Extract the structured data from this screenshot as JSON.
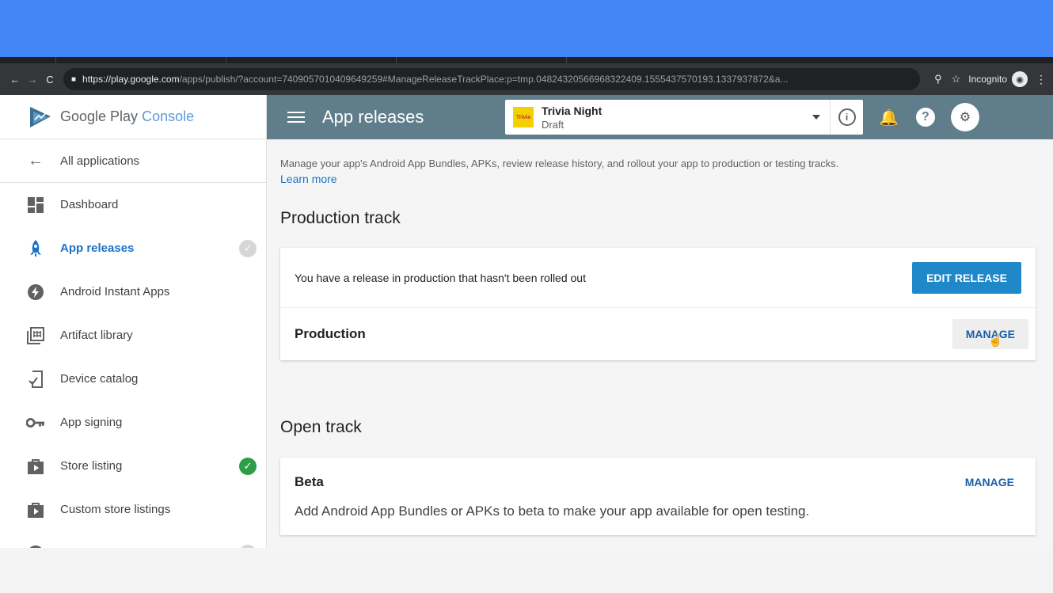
{
  "browser": {
    "url_host": "https://play.google.com",
    "url_path": "/apps/publish/?account=7409057010409649259#ManageReleaseTrackPlace:p=tmp.04824320566968322409.1555437570193.1337937872&a...",
    "mode_label": "Incognito"
  },
  "brand": {
    "name": "Google Play",
    "product": "Console"
  },
  "sidebar": {
    "back_label": "All applications",
    "items": [
      {
        "label": "Dashboard",
        "icon": "dashboard-icon"
      },
      {
        "label": "App releases",
        "icon": "rocket-icon",
        "active": true,
        "status": "grey-check"
      },
      {
        "label": "Android Instant Apps",
        "icon": "bolt-icon"
      },
      {
        "label": "Artifact library",
        "icon": "library-icon"
      },
      {
        "label": "Device catalog",
        "icon": "device-icon"
      },
      {
        "label": "App signing",
        "icon": "key-icon"
      },
      {
        "label": "Store listing",
        "icon": "store-icon",
        "status": "green-check"
      },
      {
        "label": "Custom store listings",
        "icon": "store-icon"
      }
    ]
  },
  "appbar": {
    "title": "App releases",
    "app_name": "Trivia Night",
    "app_state": "Draft",
    "app_icon_text": "Trivia"
  },
  "main": {
    "intro": "Manage your app's Android App Bundles, APKs, review release history, and rollout your app to production or testing tracks.",
    "learn_more": "Learn more",
    "production": {
      "heading": "Production track",
      "message": "You have a release in production that hasn't been rolled out",
      "edit_button": "EDIT RELEASE",
      "track_name": "Production",
      "manage_button": "MANAGE"
    },
    "open": {
      "heading": "Open track",
      "track_name": "Beta",
      "manage_button": "MANAGE",
      "description": "Add Android App Bundles or APKs to beta to make your app available for open testing."
    }
  },
  "colors": {
    "accent_band": "#4287f5",
    "appbar": "#607d8b",
    "primary_button": "#1e88c9",
    "link": "#1a73c8"
  }
}
